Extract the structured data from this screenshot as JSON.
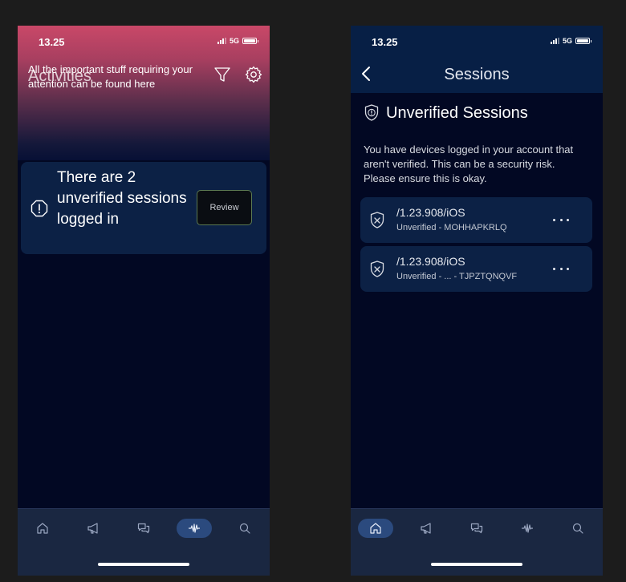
{
  "status_bar": {
    "time": "13.25",
    "network": "5G"
  },
  "activities": {
    "title": "Activities",
    "subtitle": "All the important stuff requiring your attention can be found here",
    "alert": {
      "text": "There are 2 unverified sessions logged in",
      "action_label": "Review"
    }
  },
  "sessions": {
    "nav_title": "Sessions",
    "section_title": "Unverified Sessions",
    "description": "You have devices logged in your account that aren't verified. This can be a security risk. Please ensure this is okay.",
    "items": [
      {
        "name": "/1.23.908/iOS",
        "status": "Unverified - MOHHAPKRLQ"
      },
      {
        "name": "/1.23.908/iOS",
        "status": "Unverified - ... - TJPZTQNQVF"
      }
    ]
  },
  "tabs": [
    {
      "icon": "home-icon"
    },
    {
      "icon": "megaphone-icon"
    },
    {
      "icon": "chat-bubbles-icon"
    },
    {
      "icon": "activity-wave-icon"
    },
    {
      "icon": "search-icon"
    }
  ],
  "tab_bars": {
    "left_active": "activity-wave-icon",
    "right_active": "home-icon"
  },
  "colors": {
    "accent": "#2b4a7e",
    "background": "#020823",
    "card": "#0c2145",
    "header_gradient_top": "#c94868"
  }
}
